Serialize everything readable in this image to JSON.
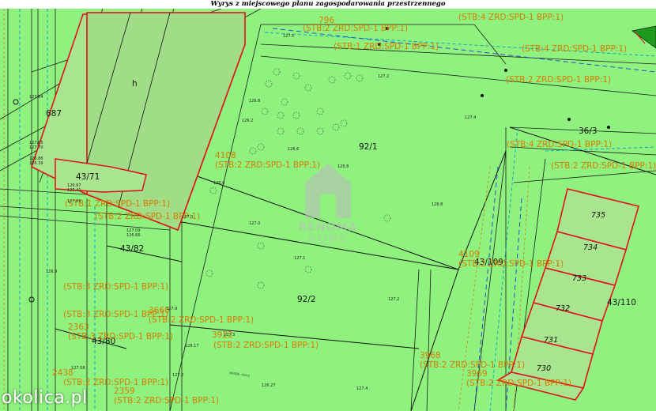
{
  "title": "Wyrys z miejscowego planu zagospodarowania przestrzennego",
  "colors": {
    "background": "#8ff27e",
    "parcel_line": "#000000",
    "building_outline": "#e0101a",
    "building_fill": "#a9e58e",
    "zoning_text": "#d87b00",
    "utility_cyan": "#00a3c7",
    "utility_blue": "#2a4fd0"
  },
  "parcels": [
    "687",
    "h",
    "43/71",
    "92/1",
    "36/3",
    "43/82",
    "92/2",
    "43/109",
    "43/110",
    "43/80"
  ],
  "building_labels": [
    "735",
    "734",
    "733",
    "732",
    "731",
    "730"
  ],
  "zoning_labels": [
    {
      "id": "796",
      "text": "796"
    },
    {
      "id": "stb4-top",
      "text": "(STB:4 ZRD:SPD-1 BPP:1)"
    },
    {
      "id": "stb2-top",
      "text": "(STB:2 ZRD:SPD-1 BPP:1)"
    },
    {
      "id": "stb1-top",
      "text": "(STB:1 ZRD:SPD-1 BPP:1)"
    },
    {
      "id": "stb4-right1",
      "text": "(STB:4 ZRD:SPD-1 BPP:1)"
    },
    {
      "id": "stb2-right",
      "text": "(STB:2 ZRD:SPD-1 BPP:1)"
    },
    {
      "id": "stb4-right2",
      "text": "(STB:4 ZRD:SPD-1 BPP:1)"
    },
    {
      "id": "stb2-right2",
      "text": "(STB:2 ZRD:SPD-1 BPP:1)"
    },
    {
      "id": "num-4108",
      "text": "4108"
    },
    {
      "id": "stb2-4108",
      "text": "(STB:2 ZRD:SPD-1 BPP:1)"
    },
    {
      "id": "stb1-left",
      "text": "(STB:1 ZRD:SPD-1 BPP:1)"
    },
    {
      "id": "stb2-left",
      "text": "(STB:2 ZRD:SPD-1 BPP:1)"
    },
    {
      "id": "num-4109",
      "text": "4109"
    },
    {
      "id": "stb2-4109",
      "text": "(STB:2 ZRD:SPD-1 BPP:1)"
    },
    {
      "id": "stb3-left",
      "text": "(STB:3 ZRD:SPD-1 BPP:1)"
    },
    {
      "id": "num-3660",
      "text": "3660"
    },
    {
      "id": "stb3-left2",
      "text": "(STB:3 ZRD:SPD-1 BPP:1)"
    },
    {
      "id": "stb2-mid",
      "text": "(STB:2 ZRD:SPD-1 BPP:1)"
    },
    {
      "id": "num-2363",
      "text": "2363"
    },
    {
      "id": "stb3-left3",
      "text": "(STB:3 ZRD:SPD-1 BPP:1)"
    },
    {
      "id": "num-3922",
      "text": "3922"
    },
    {
      "id": "stb2-3922",
      "text": "(STB:2 ZRD:SPD-1 BPP:1)"
    },
    {
      "id": "num-3968",
      "text": "3968"
    },
    {
      "id": "stb2-3968",
      "text": "(STB:2 ZRD:SPD-1 BPP:1)"
    },
    {
      "id": "num-2438",
      "text": "2438"
    },
    {
      "id": "stb2-2438",
      "text": "(STB:2 ZRD:SPD-1 BPP:1)"
    },
    {
      "id": "num-3969",
      "text": "3969"
    },
    {
      "id": "stb2-3969",
      "text": "(STB:2 ZRD:SPD-1 BPP:1)"
    },
    {
      "id": "num-2359",
      "text": "2359"
    },
    {
      "id": "stb2-2359",
      "text": "(STB:2 ZRD:SPD-1 BPP:1)"
    }
  ],
  "elevations": [
    "127.5",
    "127.2",
    "126.8",
    "126.2",
    "126.6",
    "126.8",
    "126.8",
    "126.8",
    "127.0",
    "127.1",
    "127.0",
    "127.3",
    "127.4",
    "127.9",
    "128.17",
    "127.2",
    "127.2",
    "127.4",
    "126.27",
    "126.9",
    "127.58",
    "127.04",
    "127.05",
    "127.70",
    "126.86",
    "126.39",
    "126.97",
    "126.41",
    "127.00",
    "127.09",
    "126.66"
  ],
  "street_label": "9A206 -niecz",
  "watermark": {
    "brand": "RENOMA",
    "sub": "HOME"
  },
  "logo_text": "okolica.pl"
}
